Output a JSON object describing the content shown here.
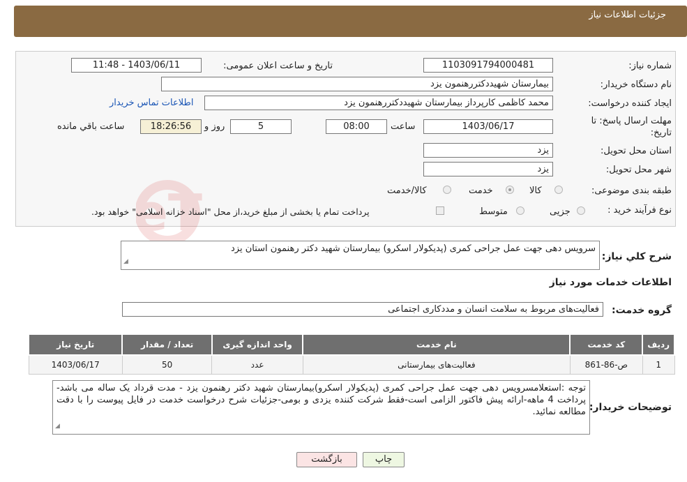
{
  "header": {
    "title": "جزئیات اطلاعات نیاز"
  },
  "form": {
    "need_number": {
      "label": "شماره نیاز:",
      "value": "1103091794000481"
    },
    "announce_datetime": {
      "label": "تاریخ و ساعت اعلان عمومی:",
      "value": "1403/06/11 - 11:48"
    },
    "buyer_org": {
      "label": "نام دستگاه خریدار:",
      "value": "بیمارستان شهیددکتررهنمون یزد"
    },
    "requester": {
      "label": "ایجاد کننده درخواست:",
      "value": "محمد کاظمی کارپرداز بیمارستان شهیددکتررهنمون یزد"
    },
    "contact_link": "اطلاعات تماس خریدار",
    "deadline": {
      "label_line1": "مهلت ارسال پاسخ: تا",
      "label_line2": "تاریخ:",
      "date": "1403/06/17",
      "time_label": "ساعت",
      "time": "08:00",
      "days": "5",
      "days_label": "روز و",
      "remaining": "18:26:56",
      "remaining_label": "ساعت باقي مانده"
    },
    "province": {
      "label": "استان محل تحویل:",
      "value": "یزد"
    },
    "city": {
      "label": "شهر محل تحویل:",
      "value": "یزد"
    },
    "category": {
      "label": "طبقه بندی موضوعی:",
      "options": [
        "کالا",
        "خدمت",
        "کالا/خدمت"
      ],
      "selected": "خدمت"
    },
    "purchase_type": {
      "label": "نوع فرآیند خرید :",
      "options": [
        "جزیی",
        "متوسط"
      ],
      "note": "پرداخت تمام یا بخشی از مبلغ خرید،از محل \"اسناد خزانه اسلامی\" خواهد بود."
    }
  },
  "summary": {
    "label": "شرح کلي نياز:",
    "value": "سرویس دهی جهت عمل جراحی کمری (پدیکولار اسکرو) بیمارستان شهید دکتر رهنمون استان یزد"
  },
  "services_section": {
    "title": "اطلاعات خدمات مورد نیاز"
  },
  "service_group": {
    "label": "گروه خدمت:",
    "value": "فعالیت‌های مربوط به سلامت انسان و مددکاری اجتماعی"
  },
  "table": {
    "headers": [
      "ردیف",
      "کد خدمت",
      "نام خدمت",
      "واحد اندازه گیری",
      "تعداد / مقدار",
      "تاریخ نیاز"
    ],
    "rows": [
      [
        "1",
        "ص-86-861",
        "فعالیت‌های بیمارستانی",
        "عدد",
        "50",
        "1403/06/17"
      ]
    ]
  },
  "buyer_notes": {
    "label": "توضیحات خریدار:",
    "value": "توجه :استعلامسرویس دهی جهت عمل جراحی کمری (پدیکولار اسکرو)بیمارستان شهید دکتر رهنمون یزد - مدت قرداد یک ساله می باشد-پرداخت 4 ماهه-ارائه پیش فاکتور الزامی است-فقط شرکت کننده یزدی و بومی-جزئیات شرح درخواست خدمت در فایل پیوست را با دقت مطالعه نمائید."
  },
  "buttons": {
    "print": "چاپ",
    "back": "بازگشت"
  },
  "colors": {
    "header": "#8a6a42",
    "table_header": "#6f6f6f",
    "print_btn": "#eef7e2",
    "back_btn": "#fbe4e4"
  },
  "watermark": "AriaTender.neT"
}
